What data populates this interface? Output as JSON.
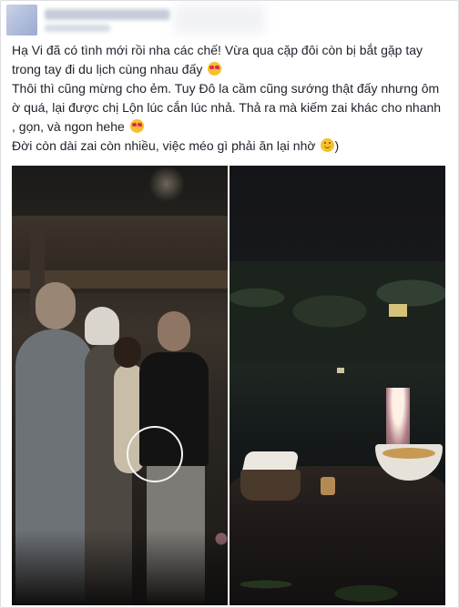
{
  "post": {
    "text_lines": [
      "Hạ Vi đã có tình mới rồi nha các chế! Vừa qua cặp đôi còn bị bắt gặp tay",
      "trong tay đi du lịch cùng nhau đấy",
      "Thôi thì cũng mừng cho ẻm. Tuy Đô la cầm cũng sướng thật đấy nhưng ôm",
      "ờ quá, lại được chị Lộn lúc cắn lúc nhả. Thả ra mà kiếm zai khác cho nhanh",
      ", gọn, và ngon hehe",
      "Đời còn dài zai còn nhiều, việc méo gì phải ăn lại nhờ",
      ")"
    ],
    "emojis": [
      "heart-eyes-emoji",
      "heart-eyes-emoji",
      "smile-emoji"
    ],
    "photos": [
      "left-photo-couple-street",
      "right-photo-night-dinner-table"
    ]
  },
  "colors": {
    "text": "#1d2129",
    "background": "#e9ebee",
    "card": "#ffffff",
    "highlight_circle": "#f5f5f5"
  }
}
